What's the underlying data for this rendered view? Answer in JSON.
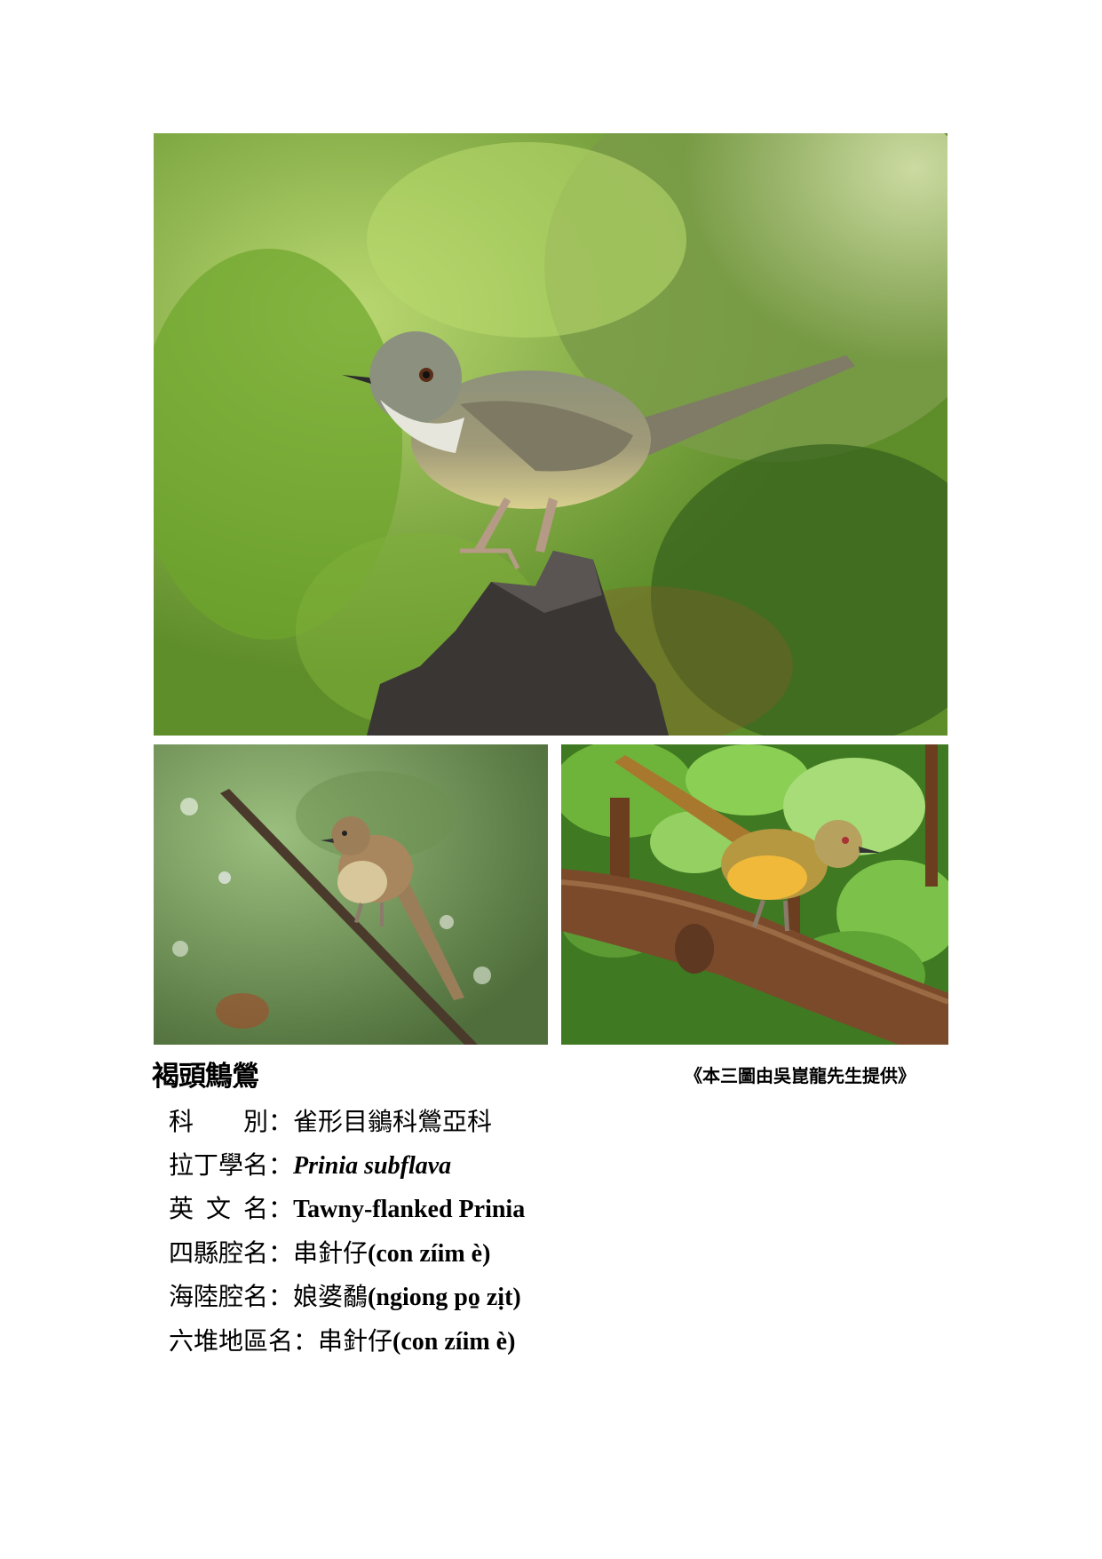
{
  "page": {
    "species_title": "褐頭鷦鶯",
    "photo_credit": "《本三圖由吳崑龍先生提供》"
  },
  "photos": {
    "main": {
      "description": "bird-on-stump"
    },
    "left": {
      "description": "bird-on-twig"
    },
    "right": {
      "description": "bird-on-branch"
    }
  },
  "fields": {
    "family": {
      "label_a": "科",
      "label_b": "別",
      "colon": "：",
      "value": "雀形目鶲科鶯亞科"
    },
    "latin": {
      "label": "拉丁學名",
      "colon": "：",
      "value": "Prinia subflava"
    },
    "english": {
      "label_a": "英",
      "label_b": "文",
      "label_c": "名",
      "colon": "：",
      "value": "Tawny-flanked Prinia"
    },
    "sixian": {
      "label": "四縣腔名",
      "colon": "：",
      "value_cjk": "串針仔",
      "value_rom": "(con zíim è)"
    },
    "hailu": {
      "label": "海陸腔名",
      "colon": "：",
      "value_cjk": "娘婆鷸",
      "value_rom": "(ngiong po̱ zịt)"
    },
    "liudui": {
      "label": "六堆地區名",
      "colon": "：",
      "value_cjk": "串針仔",
      "value_rom": "(con zíim è)"
    }
  }
}
